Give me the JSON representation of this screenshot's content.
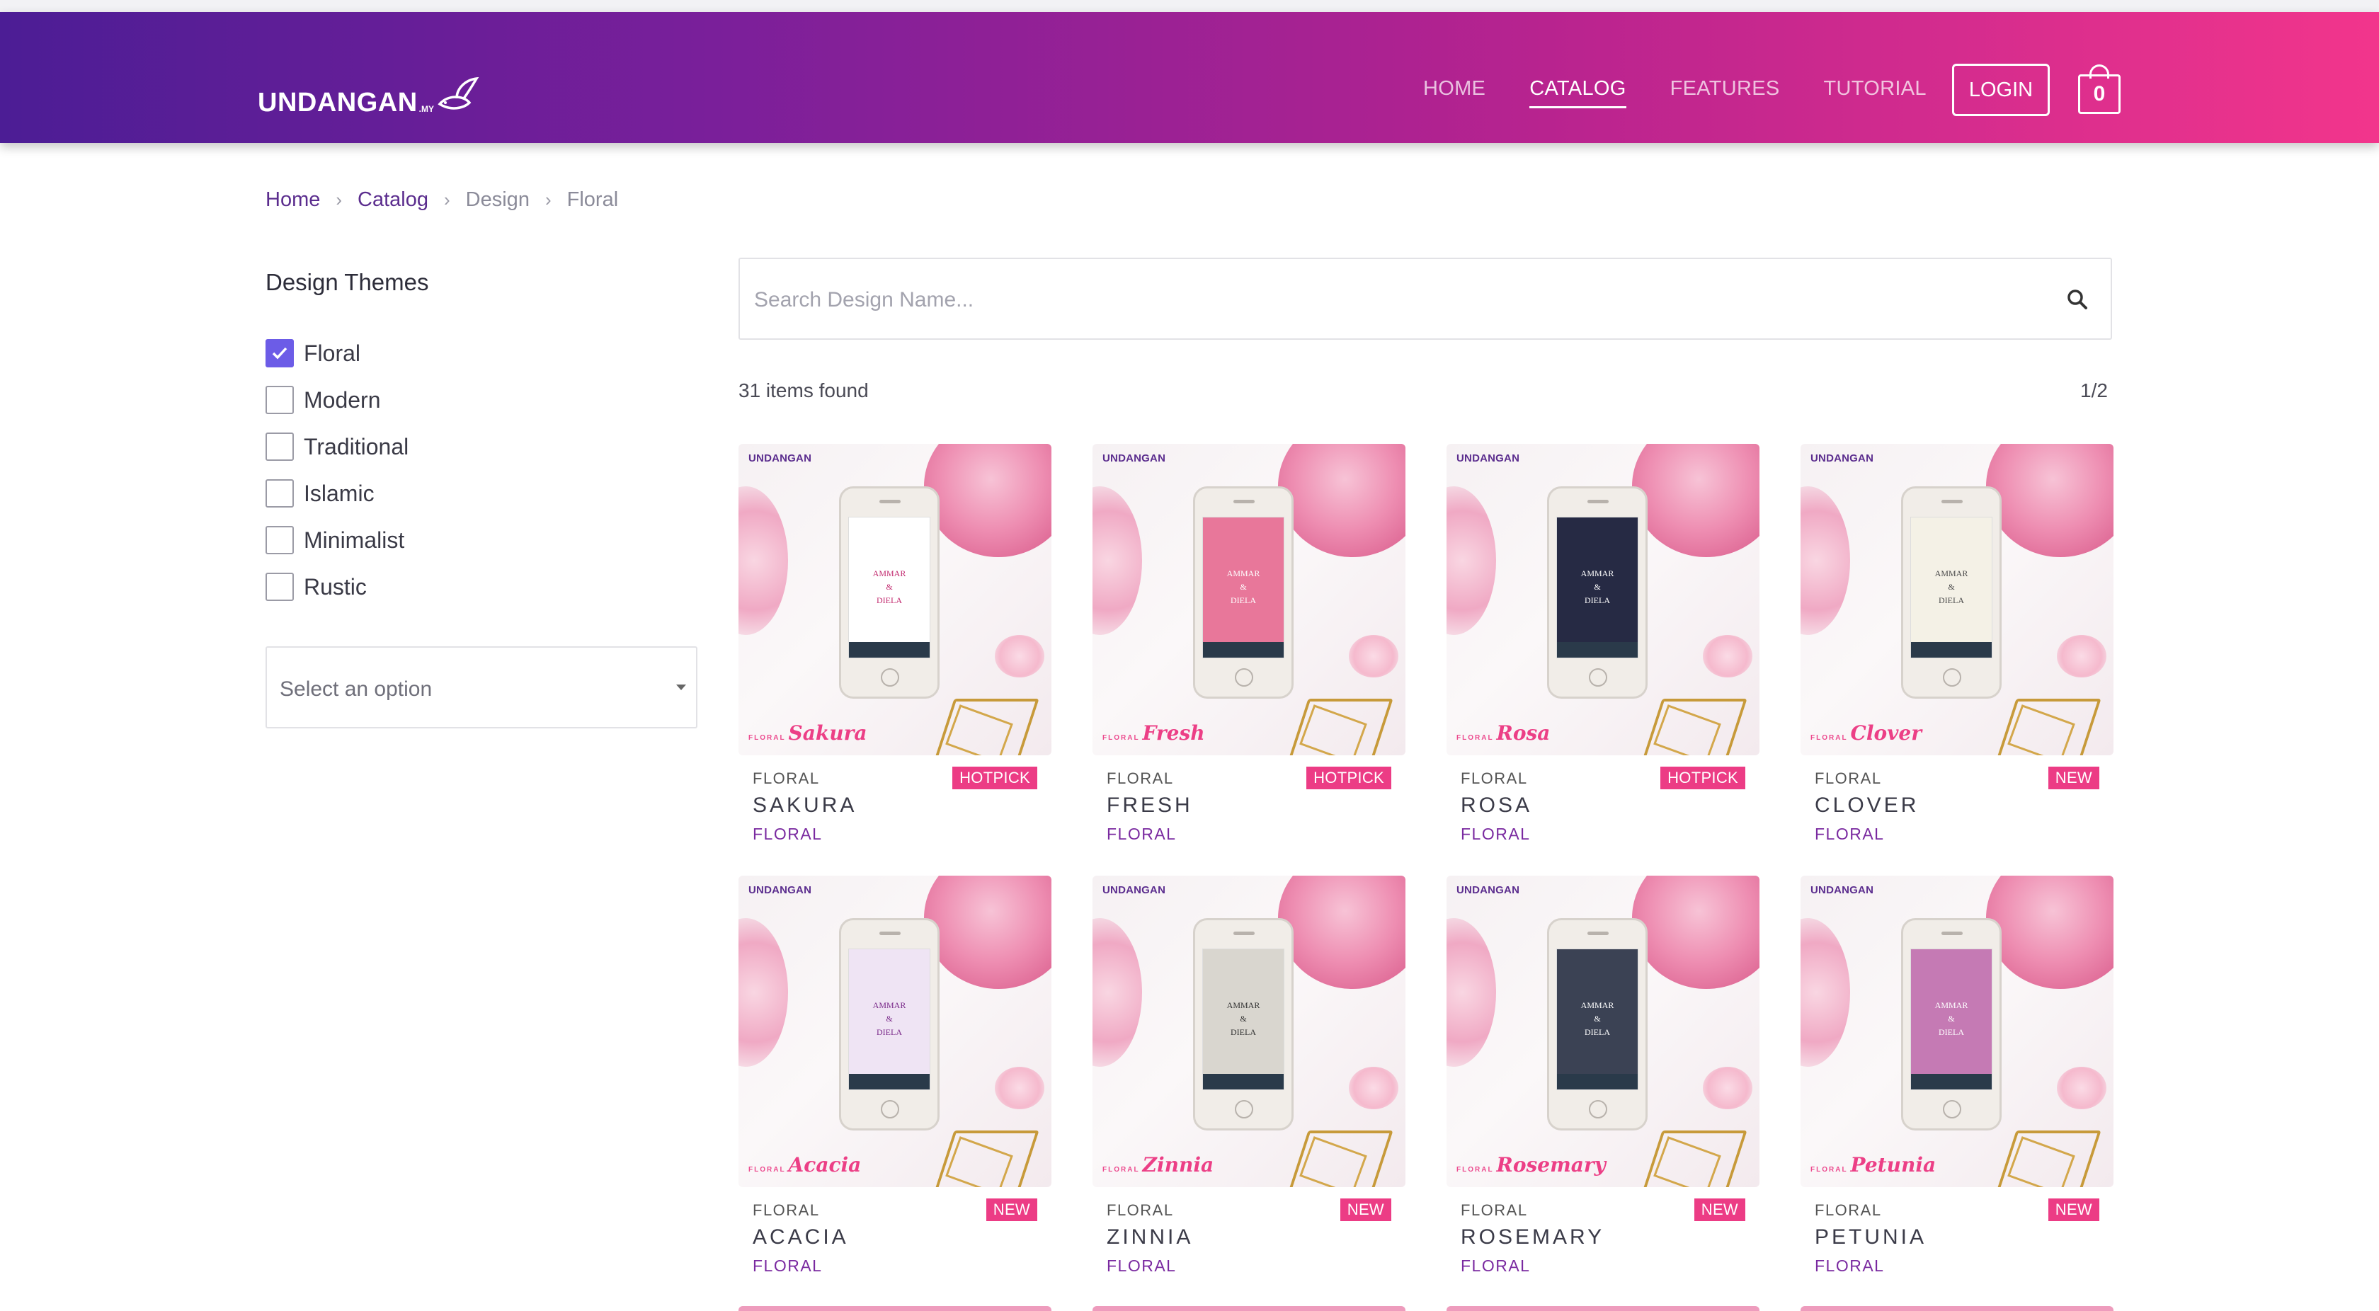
{
  "brand": {
    "name": "UNDANGAN",
    "suffix": ".MY"
  },
  "nav": {
    "items": [
      {
        "label": "HOME",
        "active": false
      },
      {
        "label": "CATALOG",
        "active": true
      },
      {
        "label": "FEATURES",
        "active": false
      },
      {
        "label": "TUTORIAL",
        "active": false
      }
    ],
    "login_label": "LOGIN",
    "cart_count": "0"
  },
  "breadcrumb": [
    "Home",
    "Catalog",
    "Design",
    "Floral"
  ],
  "sidebar": {
    "title": "Design Themes",
    "filters": [
      {
        "label": "Floral",
        "checked": true
      },
      {
        "label": "Modern",
        "checked": false
      },
      {
        "label": "Traditional",
        "checked": false
      },
      {
        "label": "Islamic",
        "checked": false
      },
      {
        "label": "Minimalist",
        "checked": false
      },
      {
        "label": "Rustic",
        "checked": false
      }
    ],
    "select_placeholder": "Select an option"
  },
  "search": {
    "placeholder": "Search Design Name..."
  },
  "results": {
    "count_text": "31 items found",
    "page_text": "1/2"
  },
  "invitation": {
    "name1": "AMMAR",
    "amp": "&",
    "name2": "DIELA"
  },
  "cards": [
    {
      "category": "FLORAL",
      "name": "SAKURA",
      "tag": "FLORAL",
      "badge": "HOTPICK",
      "collection_small": "FLORAL",
      "collection_name": "Sakura",
      "screen_bg": "#ffffff",
      "screen_text": "#c22a6f"
    },
    {
      "category": "FLORAL",
      "name": "FRESH",
      "tag": "FLORAL",
      "badge": "HOTPICK",
      "collection_small": "FLORAL",
      "collection_name": "Fresh",
      "screen_bg": "#e8779a",
      "screen_text": "#ffffff"
    },
    {
      "category": "FLORAL",
      "name": "ROSA",
      "tag": "FLORAL",
      "badge": "HOTPICK",
      "collection_small": "FLORAL",
      "collection_name": "Rosa",
      "screen_bg": "#262a44",
      "screen_text": "#ffffff"
    },
    {
      "category": "FLORAL",
      "name": "CLOVER",
      "tag": "FLORAL",
      "badge": "NEW",
      "collection_small": "FLORAL",
      "collection_name": "Clover",
      "screen_bg": "#f4f1e6",
      "screen_text": "#4a4a4a"
    },
    {
      "category": "FLORAL",
      "name": "ACACIA",
      "tag": "FLORAL",
      "badge": "NEW",
      "collection_small": "FLORAL",
      "collection_name": "Acacia",
      "screen_bg": "#efe4f4",
      "screen_text": "#7a2a8a"
    },
    {
      "category": "FLORAL",
      "name": "ZINNIA",
      "tag": "FLORAL",
      "badge": "NEW",
      "collection_small": "FLORAL",
      "collection_name": "Zinnia",
      "screen_bg": "#d9d6cf",
      "screen_text": "#333333"
    },
    {
      "category": "FLORAL",
      "name": "ROSEMARY",
      "tag": "FLORAL",
      "badge": "NEW",
      "collection_small": "FLORAL",
      "collection_name": "Rosemary",
      "screen_bg": "#3b4254",
      "screen_text": "#ffffff"
    },
    {
      "category": "FLORAL",
      "name": "PETUNIA",
      "tag": "FLORAL",
      "badge": "NEW",
      "collection_small": "FLORAL",
      "collection_name": "Petunia",
      "screen_bg": "#c57ab4",
      "screen_text": "#ffffff"
    }
  ],
  "colors": {
    "accent": "#6c5ce7",
    "badge": "#ec3c85",
    "brand_purple": "#5b2d8e"
  }
}
